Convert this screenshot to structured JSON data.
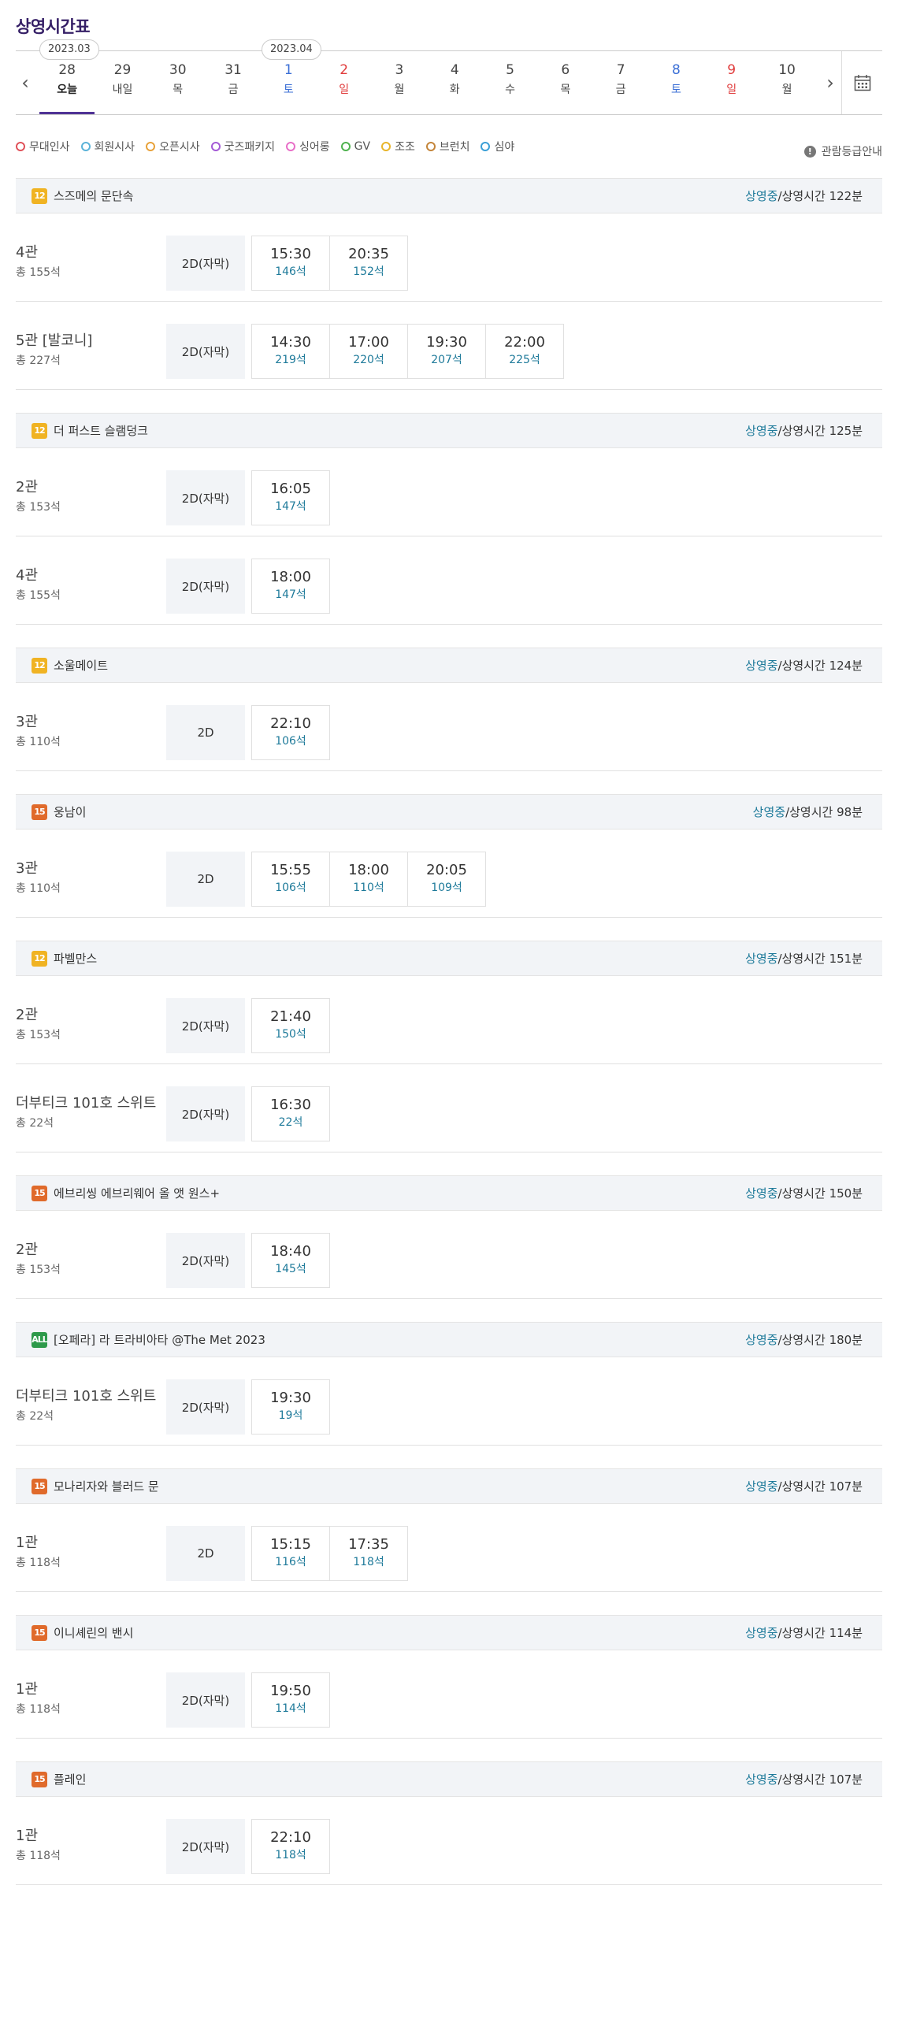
{
  "page_title": "상영시간표",
  "date_nav": {
    "months": [
      "2023.03",
      "2023.04"
    ],
    "days": [
      {
        "num": "28",
        "dow": "오늘",
        "type": "today"
      },
      {
        "num": "29",
        "dow": "내일",
        "type": "weekday"
      },
      {
        "num": "30",
        "dow": "목",
        "type": "weekday"
      },
      {
        "num": "31",
        "dow": "금",
        "type": "weekday"
      },
      {
        "num": "1",
        "dow": "토",
        "type": "sat"
      },
      {
        "num": "2",
        "dow": "일",
        "type": "sun"
      },
      {
        "num": "3",
        "dow": "월",
        "type": "weekday"
      },
      {
        "num": "4",
        "dow": "화",
        "type": "weekday"
      },
      {
        "num": "5",
        "dow": "수",
        "type": "weekday"
      },
      {
        "num": "6",
        "dow": "목",
        "type": "weekday"
      },
      {
        "num": "7",
        "dow": "금",
        "type": "weekday"
      },
      {
        "num": "8",
        "dow": "토",
        "type": "sat"
      },
      {
        "num": "9",
        "dow": "일",
        "type": "sun"
      },
      {
        "num": "10",
        "dow": "월",
        "type": "weekday"
      }
    ]
  },
  "legend": {
    "items": [
      {
        "label": "무대인사",
        "color": "#e0525a"
      },
      {
        "label": "회원시사",
        "color": "#5bb3d8"
      },
      {
        "label": "오픈시사",
        "color": "#e8a23a"
      },
      {
        "label": "굿즈패키지",
        "color": "#a45ad6"
      },
      {
        "label": "싱어롱",
        "color": "#e86fc8"
      },
      {
        "label": "GV",
        "color": "#4fb24f"
      },
      {
        "label": "조조",
        "color": "#e8b52a"
      },
      {
        "label": "브런치",
        "color": "#c4853a"
      },
      {
        "label": "심야",
        "color": "#3b9fd6"
      }
    ],
    "rating_info": "관람등급안내"
  },
  "status_label": "상영중",
  "runtime_prefix": "/상영시간 ",
  "movies": [
    {
      "rating": "12",
      "rating_color": "#f0b323",
      "title": "스즈메의 문단속",
      "runtime": "122분",
      "halls": [
        {
          "name": "4관",
          "seats": "총 155석",
          "format": "2D(자막)",
          "times": [
            {
              "time": "15:30",
              "seats": "146석"
            },
            {
              "time": "20:35",
              "seats": "152석"
            }
          ]
        },
        {
          "name": "5관 [발코니]",
          "seats": "총 227석",
          "format": "2D(자막)",
          "times": [
            {
              "time": "14:30",
              "seats": "219석"
            },
            {
              "time": "17:00",
              "seats": "220석"
            },
            {
              "time": "19:30",
              "seats": "207석"
            },
            {
              "time": "22:00",
              "seats": "225석"
            }
          ]
        }
      ]
    },
    {
      "rating": "12",
      "rating_color": "#f0b323",
      "title": "더 퍼스트 슬램덩크",
      "runtime": "125분",
      "halls": [
        {
          "name": "2관",
          "seats": "총 153석",
          "format": "2D(자막)",
          "times": [
            {
              "time": "16:05",
              "seats": "147석"
            }
          ]
        },
        {
          "name": "4관",
          "seats": "총 155석",
          "format": "2D(자막)",
          "times": [
            {
              "time": "18:00",
              "seats": "147석"
            }
          ]
        }
      ]
    },
    {
      "rating": "12",
      "rating_color": "#f0b323",
      "title": "소울메이트",
      "runtime": "124분",
      "halls": [
        {
          "name": "3관",
          "seats": "총 110석",
          "format": "2D",
          "times": [
            {
              "time": "22:10",
              "seats": "106석"
            }
          ]
        }
      ]
    },
    {
      "rating": "15",
      "rating_color": "#e06a2b",
      "title": "웅남이",
      "runtime": "98분",
      "halls": [
        {
          "name": "3관",
          "seats": "총 110석",
          "format": "2D",
          "times": [
            {
              "time": "15:55",
              "seats": "106석"
            },
            {
              "time": "18:00",
              "seats": "110석"
            },
            {
              "time": "20:05",
              "seats": "109석"
            }
          ]
        }
      ]
    },
    {
      "rating": "12",
      "rating_color": "#f0b323",
      "title": "파벨만스",
      "runtime": "151분",
      "halls": [
        {
          "name": "2관",
          "seats": "총 153석",
          "format": "2D(자막)",
          "times": [
            {
              "time": "21:40",
              "seats": "150석"
            }
          ]
        },
        {
          "name": "더부티크 101호 스위트",
          "seats": "총 22석",
          "format": "2D(자막)",
          "times": [
            {
              "time": "16:30",
              "seats": "22석"
            }
          ]
        }
      ]
    },
    {
      "rating": "15",
      "rating_color": "#e06a2b",
      "title": "에브리씽 에브리웨어 올 앳 원스+",
      "runtime": "150분",
      "halls": [
        {
          "name": "2관",
          "seats": "총 153석",
          "format": "2D(자막)",
          "times": [
            {
              "time": "18:40",
              "seats": "145석"
            }
          ]
        }
      ]
    },
    {
      "rating": "ALL",
      "rating_color": "#2e9a4a",
      "title": "[오페라] 라 트라비아타 @The Met 2023",
      "runtime": "180분",
      "halls": [
        {
          "name": "더부티크 101호 스위트",
          "seats": "총 22석",
          "format": "2D(자막)",
          "times": [
            {
              "time": "19:30",
              "seats": "19석"
            }
          ]
        }
      ]
    },
    {
      "rating": "15",
      "rating_color": "#e06a2b",
      "title": "모나리자와 블러드 문",
      "runtime": "107분",
      "halls": [
        {
          "name": "1관",
          "seats": "총 118석",
          "format": "2D",
          "times": [
            {
              "time": "15:15",
              "seats": "116석"
            },
            {
              "time": "17:35",
              "seats": "118석"
            }
          ]
        }
      ]
    },
    {
      "rating": "15",
      "rating_color": "#e06a2b",
      "title": "이니셰린의 밴시",
      "runtime": "114분",
      "halls": [
        {
          "name": "1관",
          "seats": "총 118석",
          "format": "2D(자막)",
          "times": [
            {
              "time": "19:50",
              "seats": "114석"
            }
          ]
        }
      ]
    },
    {
      "rating": "15",
      "rating_color": "#e06a2b",
      "title": "플레인",
      "runtime": "107분",
      "halls": [
        {
          "name": "1관",
          "seats": "총 118석",
          "format": "2D(자막)",
          "times": [
            {
              "time": "22:10",
              "seats": "118석"
            }
          ]
        }
      ]
    }
  ]
}
